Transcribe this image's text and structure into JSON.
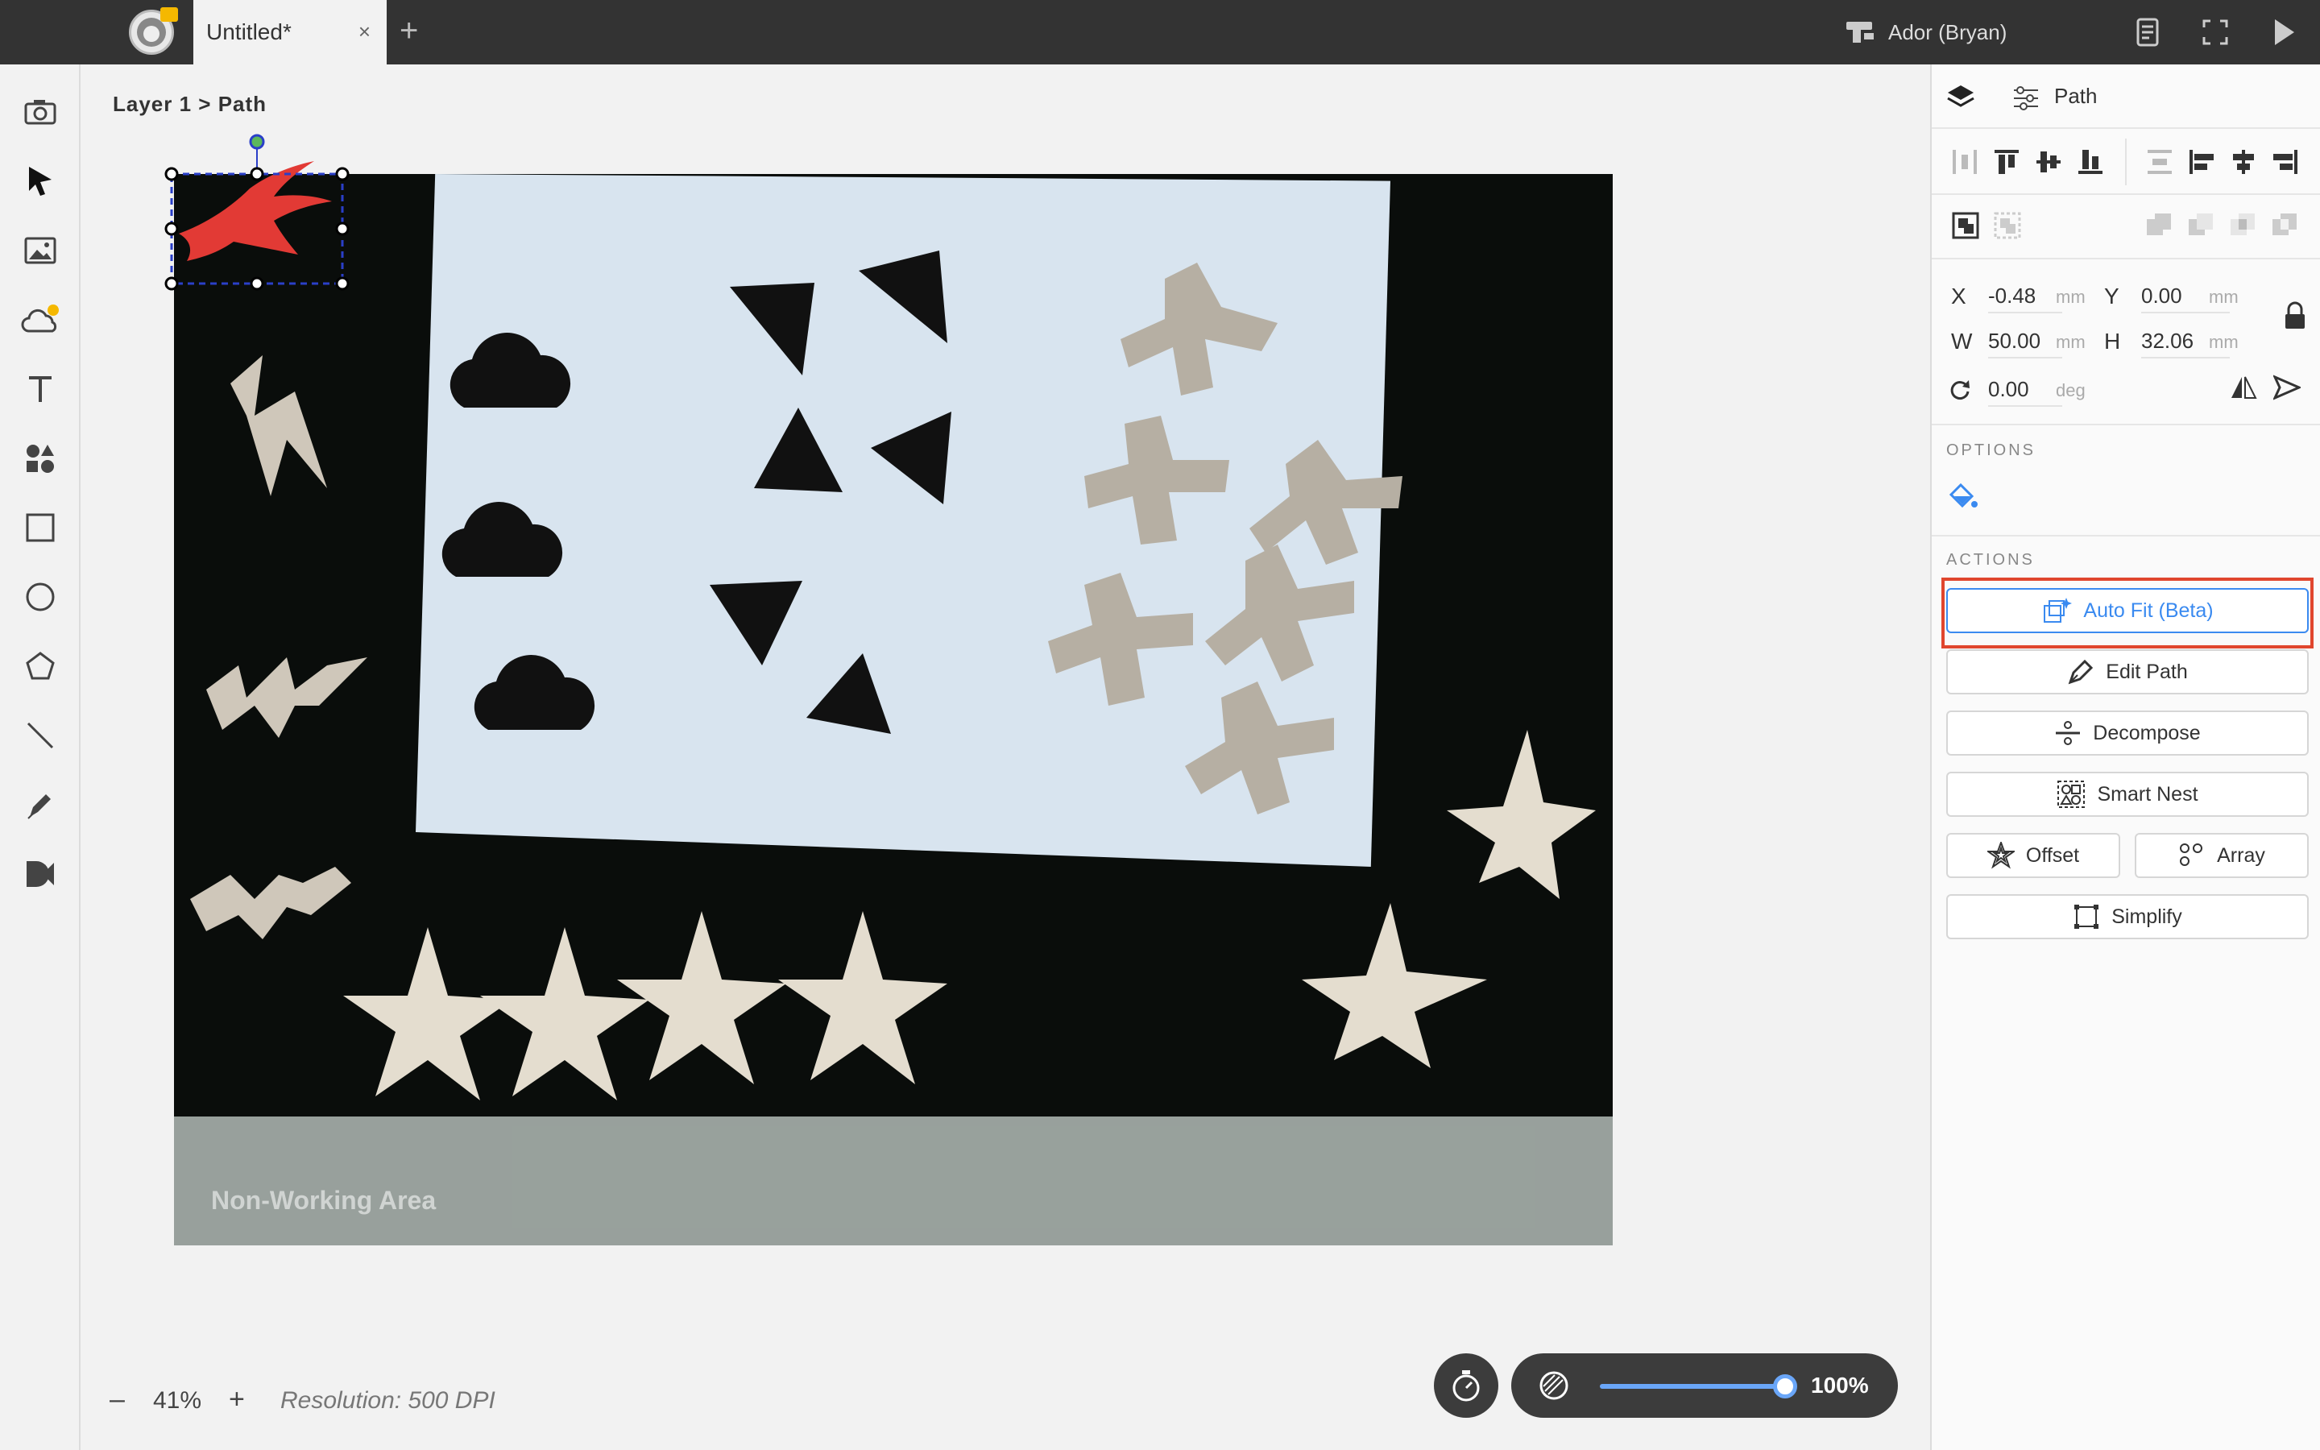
{
  "top_bar": {
    "tab_title": "Untitled*",
    "tab_close": "×",
    "tab_add": "+",
    "device_label": "Ador (Bryan)"
  },
  "canvas": {
    "breadcrumb": "Layer 1 > Path",
    "non_working_area_label": "Non-Working Area"
  },
  "zoom": {
    "minus": "–",
    "value": "41%",
    "plus": "+",
    "resolution": "Resolution: 500 DPI"
  },
  "opacity": {
    "value_label": "100%",
    "level": 1.0,
    "accent": "#6aa6f8"
  },
  "panel": {
    "title": "Path",
    "x_label": "X",
    "x_value": "-0.48",
    "x_unit": "mm",
    "y_label": "Y",
    "y_value": "0.00",
    "y_unit": "mm",
    "w_label": "W",
    "w_value": "50.00",
    "w_unit": "mm",
    "h_label": "H",
    "h_value": "32.06",
    "h_unit": "mm",
    "rotation_value": "0.00",
    "rotation_unit": "deg",
    "options_label": "OPTIONS",
    "actions_label": "ACTIONS",
    "actions": {
      "auto_fit": "Auto Fit (Beta)",
      "edit_path": "Edit Path",
      "decompose": "Decompose",
      "smart_nest": "Smart Nest",
      "offset": "Offset",
      "array": "Array",
      "simplify": "Simplify"
    },
    "highlight_color": "#e0462e",
    "accent_color": "#3a8af0"
  }
}
